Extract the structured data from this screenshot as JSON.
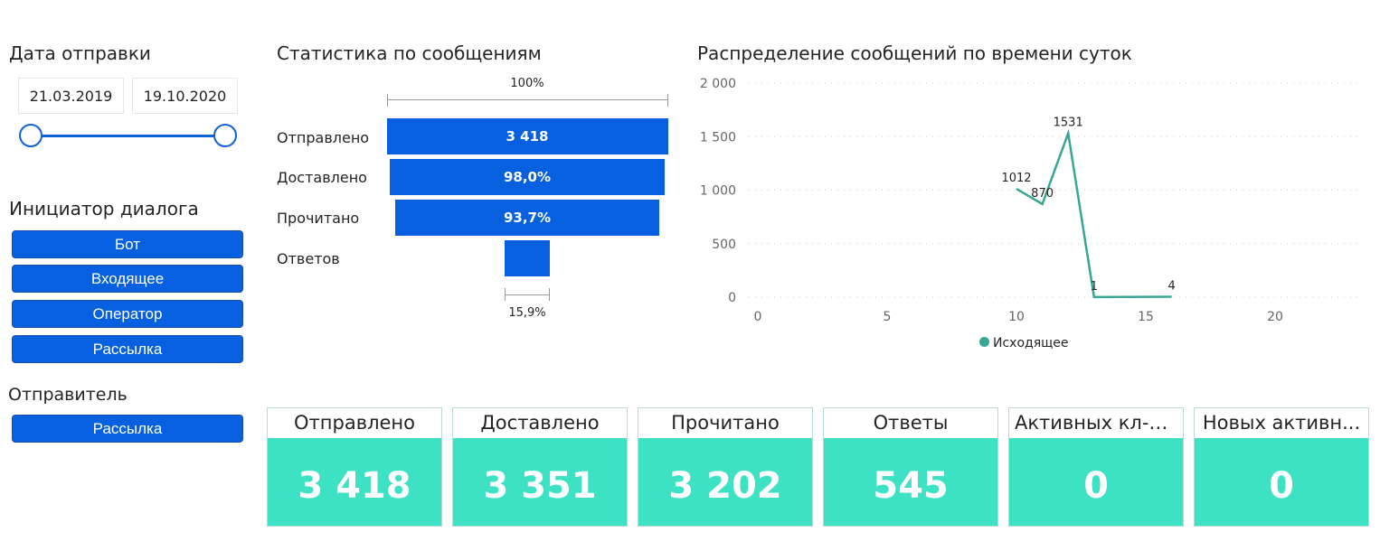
{
  "date_filter": {
    "title": "Дата отправки",
    "start": "21.03.2019",
    "end": "19.10.2020"
  },
  "initiator": {
    "title": "Инициатор диалога",
    "items": [
      "Бот",
      "Входящее",
      "Оператор",
      "Рассылка"
    ]
  },
  "sender": {
    "title": "Отправитель",
    "items": [
      "Рассылка"
    ]
  },
  "funnel": {
    "title": "Статистика по сообщениям",
    "top_label": "100%",
    "bottom_label": "15,9%",
    "stages": [
      {
        "label": "Отправлено",
        "value_text": "3 418",
        "value": 3418
      },
      {
        "label": "Доставлено",
        "value_text": "98,0%",
        "value": 3351
      },
      {
        "label": "Прочитано",
        "value_text": "93,7%",
        "value": 3202
      },
      {
        "label": "Ответов",
        "value_text": "",
        "value": 545
      }
    ],
    "color": "#0760e0"
  },
  "chart_data": {
    "type": "line",
    "title": "Распределение сообщений по времени суток",
    "x": [
      10,
      11,
      12,
      13,
      16
    ],
    "series": [
      {
        "name": "Исходящее",
        "values": [
          1012,
          870,
          1531,
          1,
          4
        ],
        "color": "#37a794"
      }
    ],
    "xlim": [
      0,
      23
    ],
    "ylim": [
      0,
      2000
    ],
    "xticks": [
      0,
      5,
      10,
      15,
      20
    ],
    "yticks": [
      0,
      500,
      1000,
      1500,
      2000
    ],
    "ytick_labels": [
      "0",
      "500",
      "1 000",
      "1 500",
      "2 000"
    ],
    "grid": true,
    "legend": "bottom"
  },
  "cards": [
    {
      "title": "Отправлено",
      "value": "3 418"
    },
    {
      "title": "Доставлено",
      "value": "3 351"
    },
    {
      "title": "Прочитано",
      "value": "3 202"
    },
    {
      "title": "Ответы",
      "value": "545"
    },
    {
      "title": "Активных кл-т...",
      "value": "0"
    },
    {
      "title": "Новых активн...",
      "value": "0"
    }
  ]
}
